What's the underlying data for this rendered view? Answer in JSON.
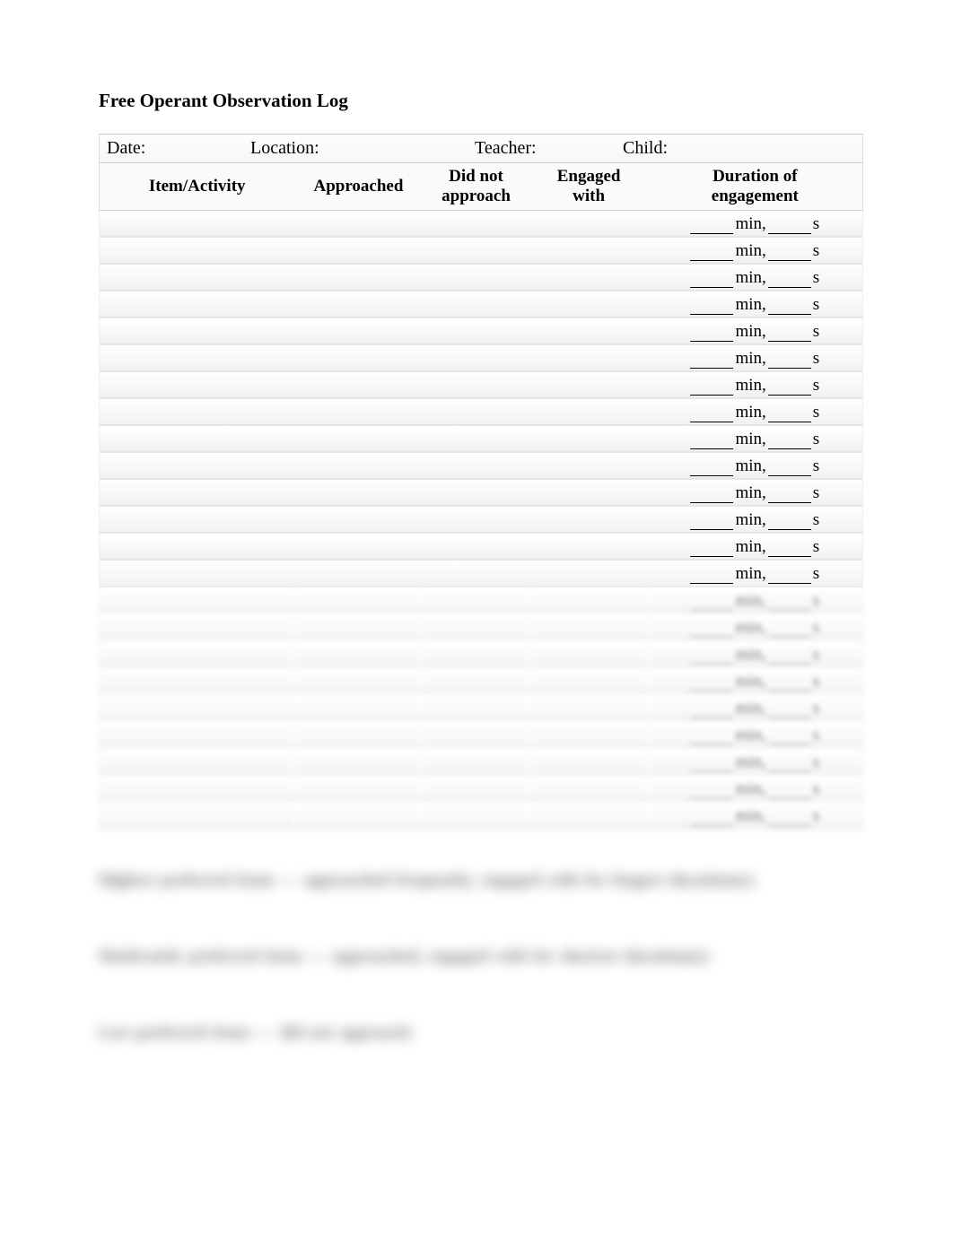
{
  "title": "Free Operant Observation Log",
  "meta": {
    "date_label": "Date:",
    "location_label": "Location:",
    "teacher_label": "Teacher:",
    "child_label": "Child:"
  },
  "headers": {
    "item": "Item/Activity",
    "approached": "Approached",
    "did_not_line1": "Did not",
    "did_not_line2": "approach",
    "engaged_line1": "Engaged",
    "engaged_line2": "with",
    "duration_line1": "Duration of",
    "duration_line2": "engagement"
  },
  "duration_unit_min": "min,",
  "duration_unit_sec": "s",
  "clear_rows": 14,
  "blur_rows": 9,
  "notes": {
    "line1": "Highest preferred items — approached frequently, engaged with for longest duration(s):",
    "line2": "Moderately preferred items — approached, engaged with for shortest duration(s):",
    "line3": "Low-preferred items — did not approach:"
  }
}
